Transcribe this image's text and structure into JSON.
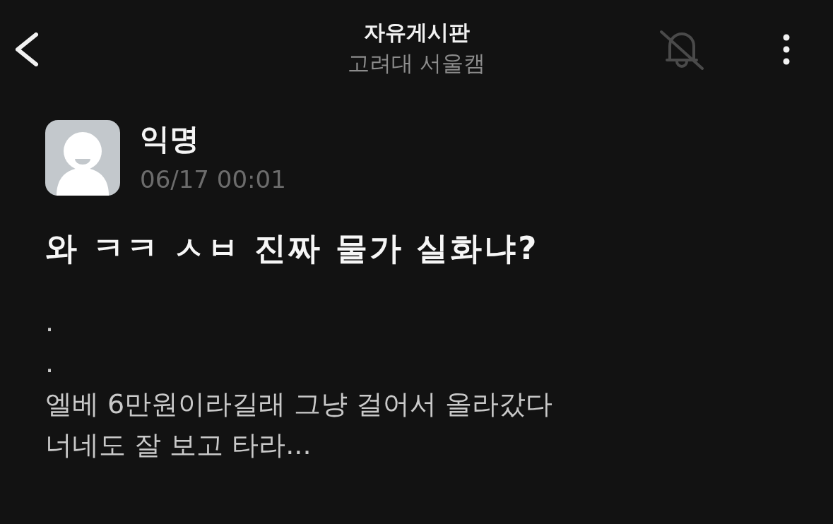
{
  "header": {
    "title": "자유게시판",
    "subtitle": "고려대 서울캠",
    "notifications_muted": true
  },
  "post": {
    "author": "익명",
    "time": "06/17 00:01",
    "title": "와 ㅋㅋ ㅅㅂ 진짜 물가 실화냐?",
    "body_lines": [
      ".",
      ".",
      "엘베 6만원이라길래 그냥 걸어서 올라갔다",
      "너네도 잘 보고 타라..."
    ]
  }
}
